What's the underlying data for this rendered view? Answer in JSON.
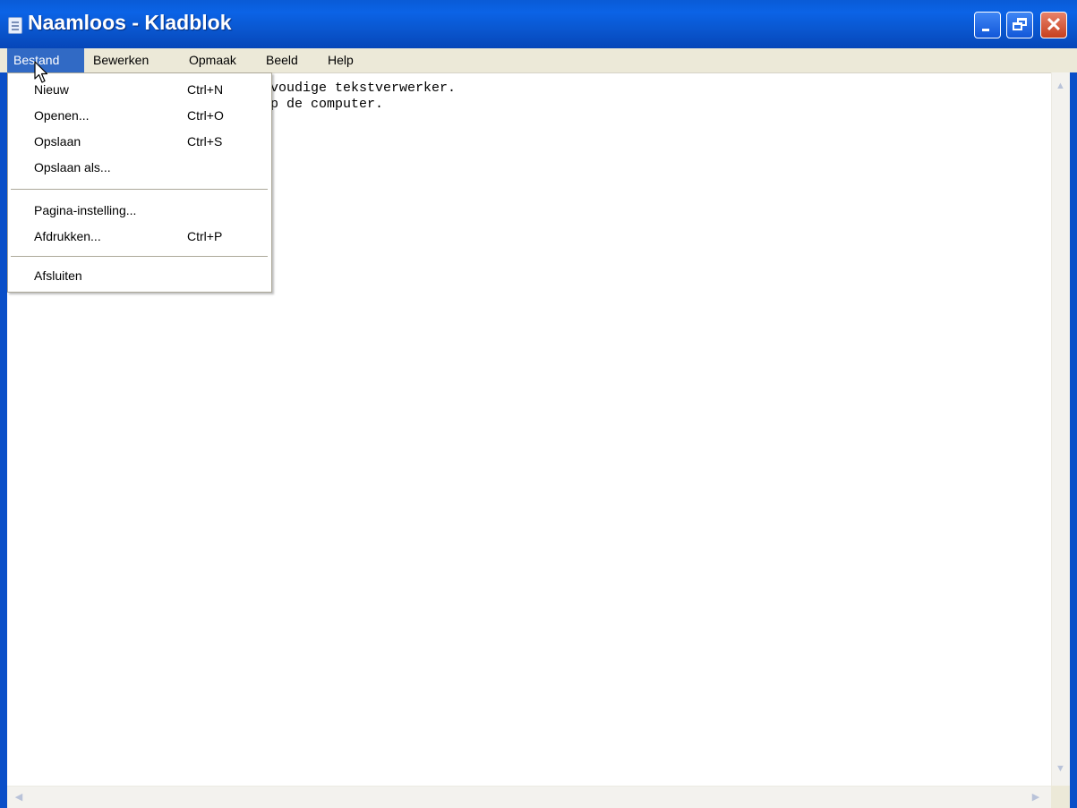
{
  "window": {
    "title": "Naamloos - Kladblok"
  },
  "menubar": [
    {
      "label": "Bestand"
    },
    {
      "label": "Bewerken"
    },
    {
      "label": "Opmaak"
    },
    {
      "label": "Beeld"
    },
    {
      "label": "Help"
    }
  ],
  "file_menu": {
    "items": [
      {
        "label": "Nieuw",
        "shortcut": "Ctrl+N"
      },
      {
        "label": "Openen...",
        "shortcut": "Ctrl+O"
      },
      {
        "label": "Opslaan",
        "shortcut": "Ctrl+S"
      },
      {
        "label": "Opslaan als...",
        "shortcut": ""
      },
      {
        "label": "Pagina-instelling...",
        "shortcut": ""
      },
      {
        "label": "Afdrukken...",
        "shortcut": "Ctrl+P"
      },
      {
        "label": "Afsluiten",
        "shortcut": ""
      }
    ]
  },
  "editor": {
    "lines": [
      "voudige tekstverwerker.",
      "p de computer."
    ]
  },
  "icons": {
    "app": "notepad-icon",
    "minimize": "minimize-icon",
    "maximize": "restore-icon",
    "close": "close-icon",
    "cursor": "mouse-pointer-icon"
  },
  "colors": {
    "titlebar": "#0a5bd6",
    "menu_active": "#316ac5",
    "menubar": "#ece9d8",
    "close_button": "#c6401f"
  }
}
